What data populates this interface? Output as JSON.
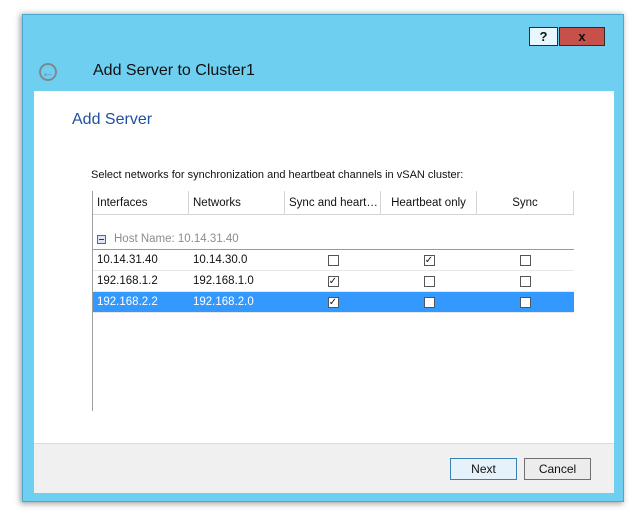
{
  "window": {
    "title": "Add Server to Cluster1",
    "help_label": "?",
    "close_label": "x"
  },
  "page": {
    "section_title": "Add Server",
    "instructions": "Select networks for synchronization and heartbeat channels in vSAN cluster:"
  },
  "grid": {
    "columns": [
      "Interfaces",
      "Networks",
      "Sync and heart…",
      "Heartbeat only",
      "Sync"
    ],
    "group_label": "Host Name: 10.14.31.40",
    "rows": [
      {
        "interface": "10.14.31.40",
        "network": "10.14.30.0",
        "sync_and_heartbeat": "",
        "heartbeat_only": "✓",
        "sync": ""
      },
      {
        "interface": "192.168.1.2",
        "network": "192.168.1.0",
        "sync_and_heartbeat": "✓",
        "heartbeat_only": "",
        "sync": ""
      },
      {
        "interface": "192.168.2.2",
        "network": "192.168.2.0",
        "sync_and_heartbeat": "✓",
        "heartbeat_only": "",
        "sync": "",
        "selected": true
      }
    ]
  },
  "buttons": {
    "next": "Next",
    "cancel": "Cancel"
  },
  "icons": {
    "back": "back-arrow-icon",
    "collapse": "collapse-minus-icon",
    "check": "checkmark-icon"
  },
  "colors": {
    "title_bar": "#6ecff0",
    "section_title": "#1f4f9e",
    "selection": "#3399ff",
    "close_button": "#c7504a"
  }
}
